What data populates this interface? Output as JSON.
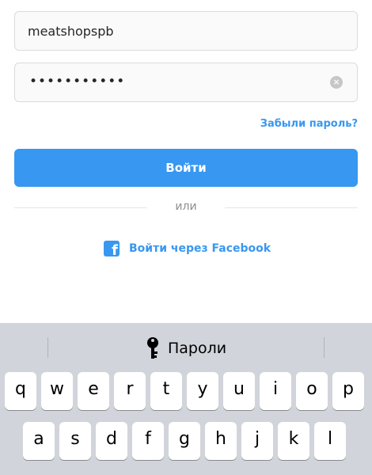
{
  "login": {
    "username_value": "meatshopspb",
    "password_masked": "•••••••••••",
    "forgot_password": "Забыли пароль?",
    "login_button": "Войти",
    "divider_text": "или",
    "facebook_login": "Войти через Facebook"
  },
  "keyboard": {
    "suggestion_label": "Пароли",
    "row1": [
      "q",
      "w",
      "e",
      "r",
      "t",
      "y",
      "u",
      "i",
      "o",
      "p"
    ],
    "row2": [
      "a",
      "s",
      "d",
      "f",
      "g",
      "h",
      "j",
      "k",
      "l"
    ]
  },
  "colors": {
    "accent": "#3897f0",
    "field_bg": "#fafafa",
    "keyboard_bg": "#d1d4da"
  },
  "icons": {
    "clear": "clear-icon",
    "facebook": "facebook-icon",
    "key": "key-icon"
  }
}
